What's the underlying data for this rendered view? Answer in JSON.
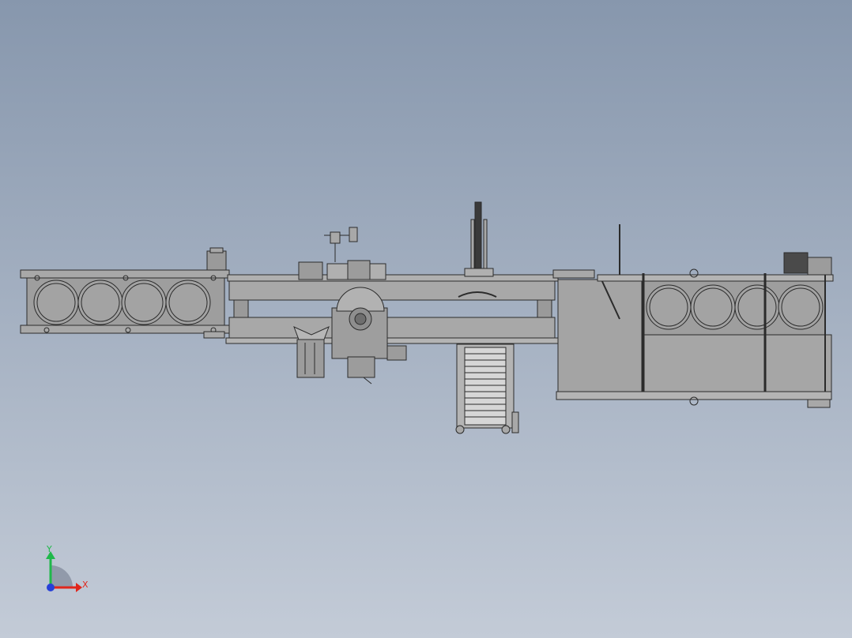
{
  "viewport": {
    "background_top": "#8797ad",
    "background_bottom": "#c3cbd7"
  },
  "model": {
    "line_color": "#2b2b2b",
    "fill_color": "#a8a8a8",
    "fill_dark": "#8c8c8c",
    "fill_light": "#bcbcbc"
  },
  "triad": {
    "x_label": "X",
    "y_label": "Y",
    "x_color": "#e0261c",
    "y_color": "#1fb84a",
    "z_color": "#2740d8"
  }
}
